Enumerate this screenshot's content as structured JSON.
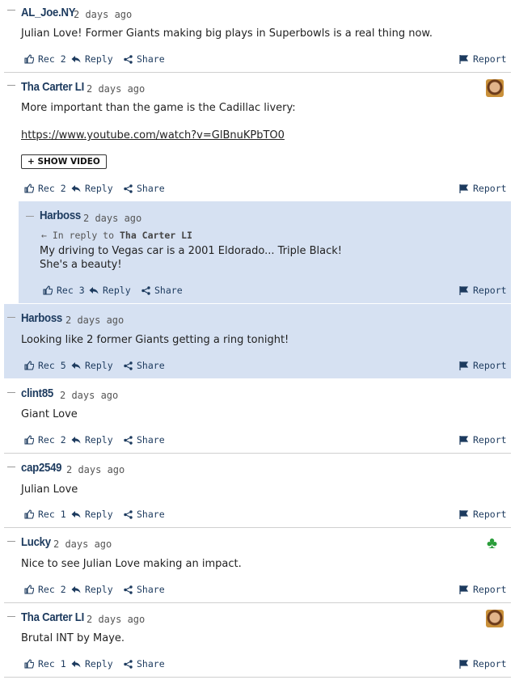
{
  "labels": {
    "reply": "Reply",
    "share": "Share",
    "report": "Report",
    "in_reply_to": "In reply to",
    "show_video": "+ SHOW VIDEO"
  },
  "comments": [
    {
      "author": "AL_Joe.NY",
      "time": "2 days ago",
      "text": "Julian Love! Former Giants making big plays in Superbowls is a real thing now.",
      "rec": "Rec 2"
    },
    {
      "author": "Tha Carter LI",
      "time": "2 days ago",
      "text": "More important than the game is the Cadillac livery:",
      "link": "https://www.youtube.com/watch?v=GlBnuKPbTO0",
      "rec": "Rec 2",
      "avatar": "portrait-avatar"
    },
    {
      "author": "Harboss",
      "time": "2 days ago",
      "reply_to": "Tha Carter LI",
      "text": "My driving to Vegas car is a 2001 Eldorado... Triple Black!",
      "text2": "She's a beauty!",
      "rec": "Rec 3"
    },
    {
      "author": "Harboss",
      "time": "2 days ago",
      "text": "Looking like 2 former Giants getting a ring tonight!",
      "rec": "Rec 5"
    },
    {
      "author": "clint85",
      "time": "2 days ago",
      "text": "Giant Love",
      "rec": "Rec 2"
    },
    {
      "author": "cap2549",
      "time": "2 days ago",
      "text": "Julian Love",
      "rec": "Rec 1"
    },
    {
      "author": "Lucky",
      "time": "2 days ago",
      "text": "Nice to see Julian Love making an impact.",
      "rec": "Rec 2",
      "avatar": "four-leaf-clover"
    },
    {
      "author": "Tha Carter LI",
      "time": "2 days ago",
      "text": "Brutal INT by Maye.",
      "rec": "Rec 1",
      "avatar": "portrait-avatar"
    }
  ],
  "colors": {
    "highlight": "#d6e1f2",
    "author": "#1c3a5e",
    "clover": "#2a9d3a"
  }
}
